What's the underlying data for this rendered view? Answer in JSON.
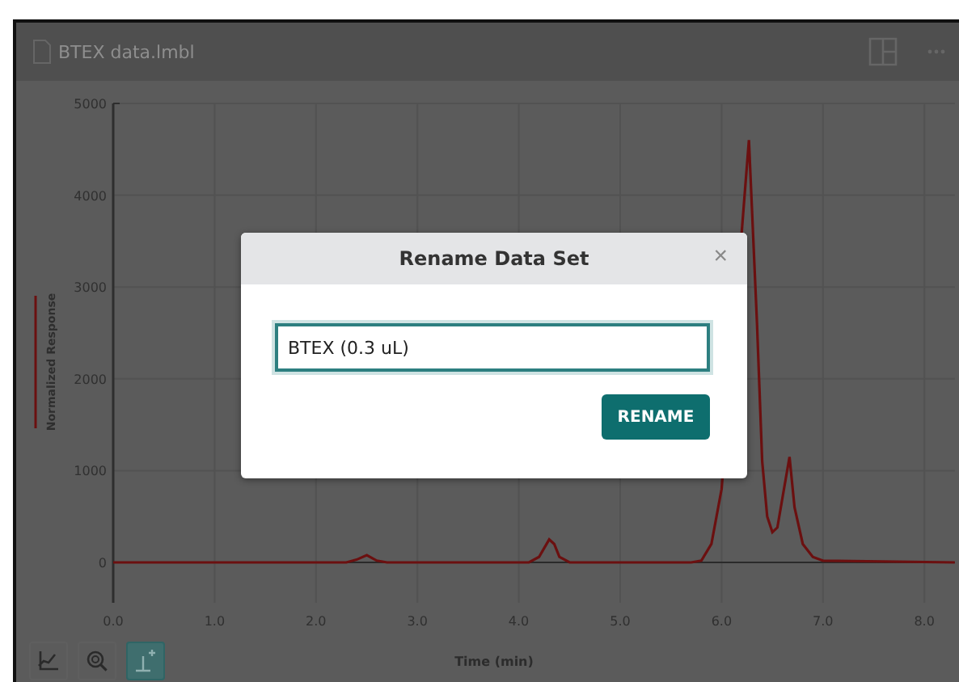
{
  "window": {
    "title": "BTEX data.lmbl"
  },
  "chart": {
    "chart_data": {
      "type": "line",
      "grid": true,
      "xlabel": "Time (min)",
      "xlim": [
        0,
        8.3
      ],
      "ylim": [
        -440,
        5000
      ],
      "xticks": [
        {
          "value": 0,
          "label": "0.0"
        },
        {
          "value": 1,
          "label": "1.0"
        },
        {
          "value": 2,
          "label": "2.0"
        },
        {
          "value": 3,
          "label": "3.0"
        },
        {
          "value": 4,
          "label": "4.0"
        },
        {
          "value": 5,
          "label": "5.0"
        },
        {
          "value": 6,
          "label": "6.0"
        },
        {
          "value": 7,
          "label": "7.0"
        },
        {
          "value": 8,
          "label": "8.0"
        }
      ],
      "yticks": [
        0,
        1000,
        2000,
        3000,
        4000,
        5000
      ],
      "x": [
        0,
        2.3,
        2.4,
        2.5,
        2.6,
        2.7,
        4.1,
        4.2,
        4.3,
        4.35,
        4.4,
        4.5,
        5.7,
        5.8,
        5.9,
        6.0,
        6.27,
        6.35,
        6.4,
        6.45,
        6.5,
        6.55,
        6.6,
        6.67,
        6.72,
        6.8,
        6.9,
        7.0,
        8.3
      ],
      "series": [
        {
          "name": "Normalized Response",
          "color": "#6b1010",
          "values": [
            0,
            0,
            30,
            80,
            20,
            0,
            0,
            60,
            250,
            200,
            60,
            0,
            0,
            20,
            200,
            800,
            4600,
            2600,
            1100,
            500,
            330,
            380,
            700,
            1150,
            600,
            200,
            60,
            20,
            0
          ]
        }
      ]
    }
  },
  "toolbar": [
    {
      "kind": "axes",
      "selected": false
    },
    {
      "kind": "zoom",
      "selected": false
    },
    {
      "kind": "peak",
      "selected": true
    }
  ],
  "dialog": {
    "title": "Rename Data Set",
    "close": "×",
    "input": {
      "value": "BTEX (0.3 uL)"
    },
    "button": "RENAME"
  }
}
